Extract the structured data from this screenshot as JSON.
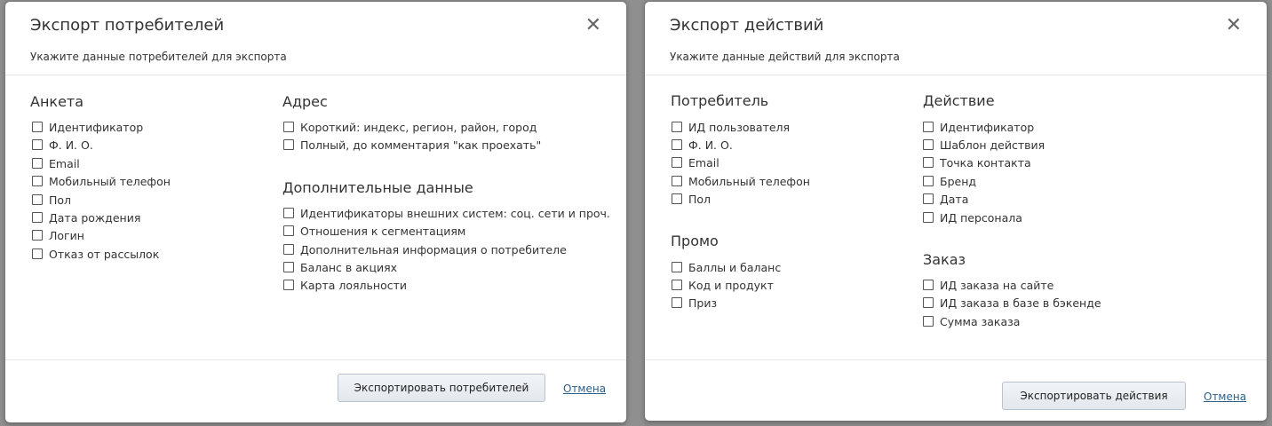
{
  "consumers_dialog": {
    "title": "Экспорт потребителей",
    "subtitle": "Укажите данные потребителей для экспорта",
    "sections": [
      {
        "title": "Анкета",
        "items": [
          "Идентификатор",
          "Ф. И. О.",
          "Email",
          "Мобильный телефон",
          "Пол",
          "Дата рождения",
          "Логин",
          "Отказ от рассылок"
        ]
      },
      {
        "title": "Адрес",
        "items": [
          "Короткий: индекс, регион, район, город",
          "Полный, до комментария \"как проехать\""
        ]
      },
      {
        "title": "Дополнительные данные",
        "items": [
          "Идентификаторы внешних систем: соц. сети и проч.",
          "Отношения к сегментациям",
          "Дополнительная информация о потребителе",
          "Баланс в акциях",
          "Карта лояльности"
        ]
      }
    ],
    "export_button": "Экспортировать потребителей",
    "cancel_link": "Отмена"
  },
  "actions_dialog": {
    "title": "Экспорт действий",
    "subtitle": "Укажите данные действий для экспорта",
    "sections": [
      {
        "title": "Потребитель",
        "items": [
          "ИД пользователя",
          "Ф. И. О.",
          "Email",
          "Мобильный телефон",
          "Пол"
        ]
      },
      {
        "title": "Промо",
        "items": [
          "Баллы и баланс",
          "Код и продукт",
          "Приз"
        ]
      },
      {
        "title": "Действие",
        "items": [
          "Идентификатор",
          "Шаблон действия",
          "Точка контакта",
          "Бренд",
          "Дата",
          "ИД персонала"
        ]
      },
      {
        "title": "Заказ",
        "items": [
          "ИД заказа на сайте",
          "ИД заказа в базе в бэкенде",
          "Сумма заказа"
        ]
      }
    ],
    "export_button": "Экспортировать действия",
    "cancel_link": "Отмена"
  }
}
